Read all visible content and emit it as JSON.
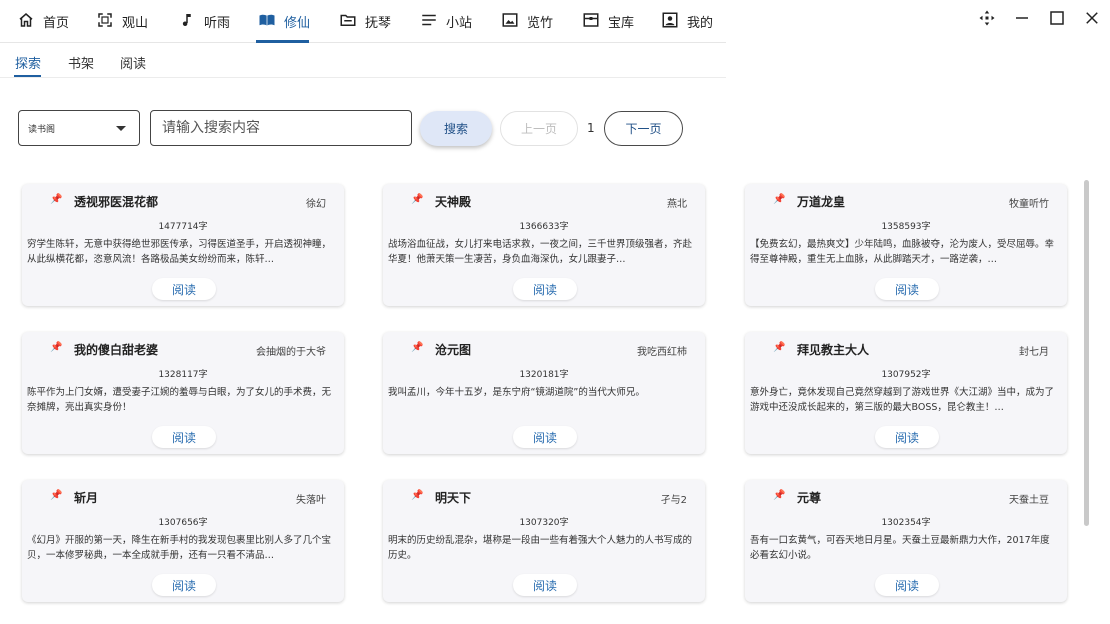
{
  "nav": {
    "items": [
      {
        "label": "首页",
        "icon": "home-icon"
      },
      {
        "label": "观山",
        "icon": "fullscreen-icon"
      },
      {
        "label": "听雨",
        "icon": "music-note-icon"
      },
      {
        "label": "修仙",
        "icon": "book-icon"
      },
      {
        "label": "抚琴",
        "icon": "folder-icon"
      },
      {
        "label": "小站",
        "icon": "list-icon"
      },
      {
        "label": "览竹",
        "icon": "image-icon"
      },
      {
        "label": "宝库",
        "icon": "treasure-icon"
      },
      {
        "label": "我的",
        "icon": "person-icon"
      }
    ],
    "active": "修仙",
    "accent": "#1f5fa0"
  },
  "window_controls": [
    "move-icon",
    "minimize-icon",
    "maximize-icon",
    "close-icon"
  ],
  "subtabs": {
    "items": [
      "探索",
      "书架",
      "阅读"
    ],
    "active": "探索"
  },
  "search": {
    "source_selected": "读书阁",
    "placeholder": "请输入搜索内容",
    "search_label": "搜索",
    "prev_label": "上一页",
    "page": "1",
    "next_label": "下一页"
  },
  "books": [
    {
      "title": "透视邪医混花都",
      "author": "徐幻",
      "count": "1477714字",
      "desc": "穷学生陈轩，无意中获得绝世邪医传承，习得医道圣手，开启透视神瞳，从此纵横花都，恣意风流！各路极品美女纷纷而来，陈轩…",
      "read": "阅读"
    },
    {
      "title": "天神殿",
      "author": "燕北",
      "count": "1366633字",
      "desc": "战场浴血征战，女儿打来电话求救，一夜之间，三千世界顶级强者，齐赴华夏！他萧天策一生凄苦，身负血海深仇，女儿跟妻子…",
      "read": "阅读"
    },
    {
      "title": "万道龙皇",
      "author": "牧童听竹",
      "count": "1358593字",
      "desc": "【免费玄幻，最热爽文】少年陆鸣，血脉被夺，沦为废人，受尽屈辱。幸得至尊神殿，重生无上血脉，从此脚踏天才，一路逆袭，…",
      "read": "阅读"
    },
    {
      "title": "我的傻白甜老婆",
      "author": "会抽烟的于大爷",
      "count": "1328117字",
      "desc": "陈平作为上门女婿，遭受妻子江婉的羞辱与白眼，为了女儿的手术费，无奈摊牌，亮出真实身份！",
      "read": "阅读"
    },
    {
      "title": "沧元图",
      "author": "我吃西红柿",
      "count": "1320181字",
      "desc": "我叫孟川，今年十五岁，是东宁府“镜湖道院”的当代大师兄。",
      "read": "阅读"
    },
    {
      "title": "拜见教主大人",
      "author": "封七月",
      "count": "1307952字",
      "desc": "意外身亡，竟休发现自己竟然穿越到了游戏世界《大江湖》当中，成为了游戏中还没成长起来的，第三版的最大BOSS，昆仑教主！…",
      "read": "阅读"
    },
    {
      "title": "斩月",
      "author": "失落叶",
      "count": "1307656字",
      "desc": "《幻月》开服的第一天，降生在新手村的我发现包裹里比别人多了几个宝贝，一本修罗秘典，一本全成就手册，还有一只看不清品…",
      "read": "阅读"
    },
    {
      "title": "明天下",
      "author": "孑与2",
      "count": "1307320字",
      "desc": "明末的历史纷乱混杂，堪称是一段由一些有着强大个人魅力的人书写成的历史。",
      "read": "阅读"
    },
    {
      "title": "元尊",
      "author": "天蚕土豆",
      "count": "1302354字",
      "desc": "吾有一口玄黄气，可吞天地日月星。天蚕土豆最新鼎力大作，2017年度必看玄幻小说。",
      "read": "阅读"
    }
  ]
}
